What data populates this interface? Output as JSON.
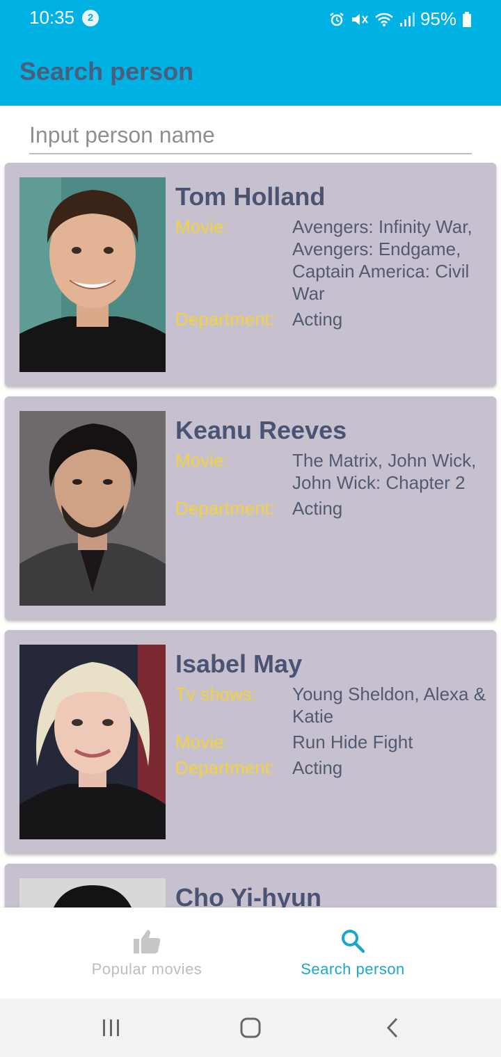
{
  "status_bar": {
    "time": "10:35",
    "notification_count": "2",
    "battery": "95%",
    "icons": [
      "alarm-icon",
      "mute-icon",
      "wifi-icon",
      "signal-icon",
      "battery-icon"
    ]
  },
  "app_bar": {
    "title": "Search person"
  },
  "search": {
    "placeholder": "Input person name",
    "value": ""
  },
  "people": [
    {
      "name": "Tom Holland",
      "rows": [
        {
          "label": "Movie:",
          "value": "Avengers: Infinity War, Avengers: Endgame, Captain America: Civil War"
        },
        {
          "label": "Department:",
          "value": "Acting"
        }
      ]
    },
    {
      "name": "Keanu Reeves",
      "rows": [
        {
          "label": "Movie:",
          "value": "The Matrix, John Wick, John Wick: Chapter 2"
        },
        {
          "label": "Department:",
          "value": "Acting"
        }
      ]
    },
    {
      "name": "Isabel May",
      "rows": [
        {
          "label": "Tv shows:",
          "value": "Young Sheldon, Alexa & Katie"
        },
        {
          "label": "Movie:",
          "value": "Run Hide Fight"
        },
        {
          "label": "Department:",
          "value": "Acting"
        }
      ]
    },
    {
      "name": "Cho Yi-hyun",
      "rows": []
    }
  ],
  "bottom_nav": {
    "items": [
      {
        "label": "Popular movies",
        "icon": "thumbs-up-icon",
        "active": false
      },
      {
        "label": "Search person",
        "icon": "search-icon",
        "active": true
      }
    ]
  },
  "colors": {
    "app_bar": "#00b2e3",
    "card": "#c7c1cf",
    "label": "#f3d23a",
    "name": "#4a5372",
    "active_nav": "#1aa6cf"
  }
}
